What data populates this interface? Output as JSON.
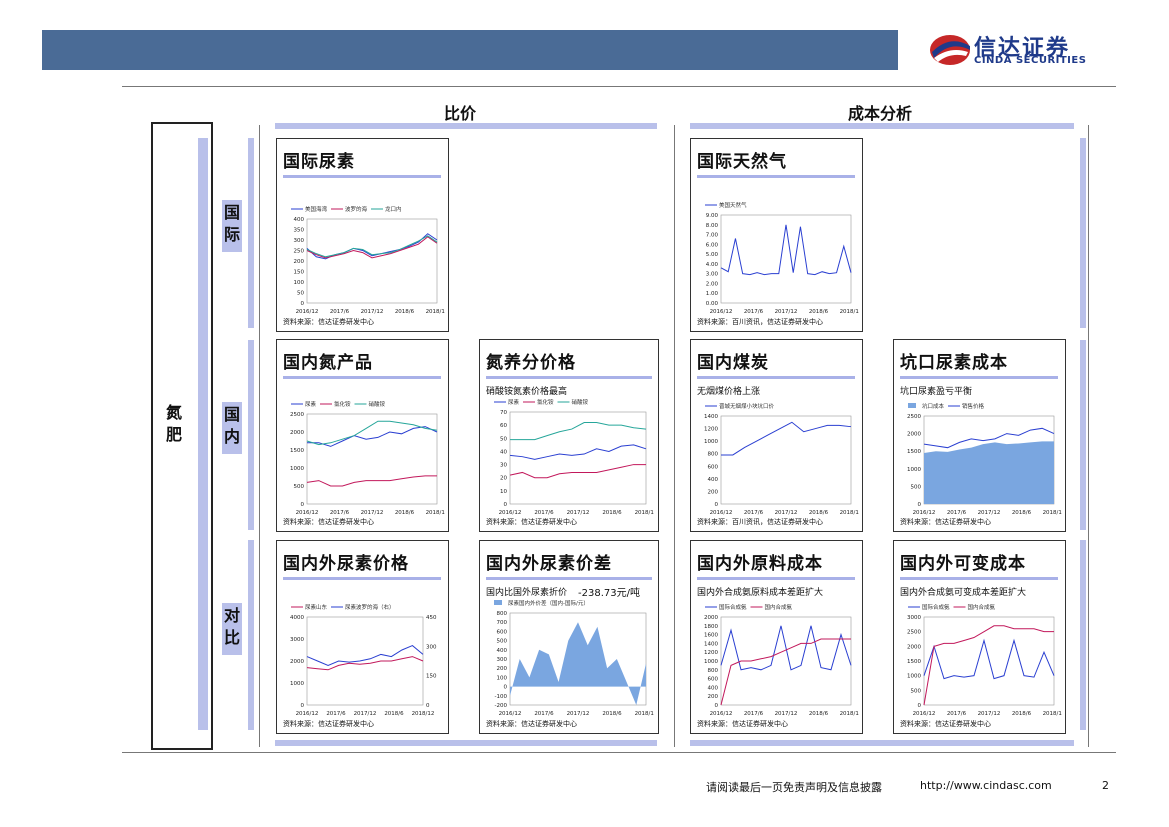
{
  "header": {
    "logo_cn": "信达证券",
    "logo_en": "CINDA SECURITIES"
  },
  "sections": {
    "left": "比价",
    "right": "成本分析"
  },
  "side": {
    "main": "氮肥",
    "rows": [
      "国际",
      "国内",
      "对比"
    ]
  },
  "panels": [
    {
      "id": "p1",
      "title": "国际尿素",
      "subtitle": "",
      "source": "资料来源：信达证券研发中心",
      "legend": [
        "美国海湾",
        "波罗的海",
        "龙口内"
      ]
    },
    {
      "id": "p2",
      "title": "国际天然气",
      "subtitle": "",
      "source": "资料来源：百川资讯，信达证券研发中心",
      "legend": [
        "美国天然气"
      ]
    },
    {
      "id": "p3",
      "title": "国内氮产品",
      "subtitle": "",
      "source": "资料来源：信达证券研发中心",
      "legend": [
        "尿素",
        "氯化铵",
        "硝酸铵"
      ]
    },
    {
      "id": "p4",
      "title": "氮养分价格",
      "subtitle": "硝酸铵氮素价格最高",
      "source": "资料来源：信达证券研发中心",
      "legend": [
        "尿素",
        "氯化铵",
        "硝酸铵"
      ]
    },
    {
      "id": "p5",
      "title": "国内煤炭",
      "subtitle": "无烟煤价格上涨",
      "source": "资料来源：百川资讯，信达证券研发中心",
      "legend": [
        "晋城无烟煤小块坑口价"
      ]
    },
    {
      "id": "p6",
      "title": "坑口尿素成本",
      "subtitle": "坑口尿素盈亏平衡",
      "source": "资料来源：信达证券研发中心",
      "legend": [
        "坑口成本",
        "销售价格"
      ]
    },
    {
      "id": "p7",
      "title": "国内外尿素价格",
      "subtitle": "",
      "source": "资料来源：信达证券研发中心",
      "legend": [
        "尿素山东",
        "尿素波罗的海（右）"
      ]
    },
    {
      "id": "p8",
      "title": "国内外尿素价差",
      "subtitle": "国内比国外尿素折价",
      "value": "-238.73元/吨",
      "source": "资料来源：信达证券研发中心",
      "legend": [
        "尿素国内外价差（国内-国际/元）"
      ]
    },
    {
      "id": "p9",
      "title": "国内外原料成本",
      "subtitle": "国内外合成氨原料成本差距扩大",
      "source": "资料来源：信达证券研发中心",
      "legend": [
        "国际合成氨",
        "国内合成氨"
      ]
    },
    {
      "id": "p10",
      "title": "国内外可变成本",
      "subtitle": "国内外合成氨可变成本差距扩大",
      "source": "资料来源：信达证券研发中心",
      "legend": [
        "国际合成氨",
        "国内合成氨"
      ]
    }
  ],
  "chart_data": [
    {
      "id": "p1",
      "type": "line",
      "x": [
        "2016/12",
        "2017/6",
        "2017/12",
        "2018/6",
        "2018/12"
      ],
      "ylim": [
        0,
        400
      ],
      "yticks": [
        0,
        50,
        100,
        150,
        200,
        250,
        300,
        350,
        400
      ],
      "series": [
        {
          "name": "美国海湾",
          "color": "#2a3fd1",
          "values": [
            260,
            220,
            210,
            230,
            240,
            260,
            250,
            225,
            235,
            245,
            255,
            270,
            290,
            330,
            300
          ]
        },
        {
          "name": "波罗的海",
          "color": "#c2185b",
          "values": [
            250,
            230,
            215,
            225,
            235,
            250,
            240,
            215,
            225,
            235,
            250,
            265,
            280,
            315,
            285
          ]
        },
        {
          "name": "龙口内",
          "color": "#26a69a",
          "values": [
            255,
            235,
            220,
            230,
            240,
            260,
            255,
            230,
            235,
            240,
            255,
            275,
            295,
            320,
            290
          ]
        }
      ]
    },
    {
      "id": "p2",
      "type": "line",
      "x": [
        "2016/12",
        "2017/6",
        "2017/12",
        "2018/6",
        "2018/12"
      ],
      "ylim": [
        0,
        9
      ],
      "yticks": [
        "0.00",
        "1.00",
        "2.00",
        "3.00",
        "4.00",
        "5.00",
        "6.00",
        "7.00",
        "8.00",
        "9.00"
      ],
      "series": [
        {
          "name": "美国天然气",
          "color": "#2a3fd1",
          "values": [
            3.6,
            3.2,
            6.6,
            3.0,
            2.9,
            3.1,
            2.9,
            3.0,
            3.0,
            8.0,
            3.1,
            7.8,
            3.0,
            2.9,
            3.2,
            3.0,
            3.1,
            5.8,
            3.1
          ]
        }
      ]
    },
    {
      "id": "p3",
      "type": "line",
      "x": [
        "2016/12",
        "2017/6",
        "2017/12",
        "2018/6",
        "2018/12"
      ],
      "ylim": [
        0,
        2500
      ],
      "yticks": [
        0,
        500,
        1000,
        1500,
        2000,
        2500
      ],
      "series": [
        {
          "name": "尿素",
          "color": "#2a3fd1",
          "values": [
            1700,
            1700,
            1600,
            1750,
            1900,
            1800,
            1850,
            2000,
            1950,
            2100,
            2150,
            2000
          ]
        },
        {
          "name": "氯化铵",
          "color": "#c2185b",
          "values": [
            600,
            650,
            500,
            500,
            600,
            650,
            650,
            650,
            700,
            750,
            780,
            780
          ]
        },
        {
          "name": "硝酸铵",
          "color": "#26a69a",
          "values": [
            1750,
            1650,
            1700,
            1800,
            1900,
            2100,
            2300,
            2300,
            2250,
            2200,
            2100,
            2050
          ]
        }
      ]
    },
    {
      "id": "p4",
      "type": "line",
      "x": [
        "2016/12",
        "2017/6",
        "2017/12",
        "2018/6",
        "2018/12"
      ],
      "ylim": [
        0,
        70
      ],
      "yticks": [
        0,
        10,
        20,
        30,
        40,
        50,
        60,
        70
      ],
      "series": [
        {
          "name": "尿素",
          "color": "#2a3fd1",
          "values": [
            37,
            36,
            34,
            36,
            38,
            37,
            38,
            42,
            40,
            44,
            45,
            42
          ]
        },
        {
          "name": "氯化铵",
          "color": "#c2185b",
          "values": [
            22,
            24,
            20,
            20,
            23,
            24,
            24,
            24,
            26,
            28,
            30,
            30
          ]
        },
        {
          "name": "硝酸铵",
          "color": "#26a69a",
          "values": [
            49,
            49,
            49,
            52,
            55,
            57,
            62,
            62,
            60,
            60,
            58,
            57
          ]
        }
      ]
    },
    {
      "id": "p5",
      "type": "line",
      "x": [
        "2016/12",
        "2017/6",
        "2017/12",
        "2018/6",
        "2018/12"
      ],
      "ylim": [
        0,
        1400
      ],
      "yticks": [
        0,
        200,
        400,
        600,
        800,
        1000,
        1200,
        1400
      ],
      "series": [
        {
          "name": "晋城无烟煤小块坑口价",
          "color": "#2a3fd1",
          "values": [
            780,
            780,
            900,
            1000,
            1100,
            1200,
            1300,
            1150,
            1200,
            1250,
            1250,
            1230
          ]
        }
      ]
    },
    {
      "id": "p6",
      "type": "area",
      "x": [
        "2016/12",
        "2017/6",
        "2017/12",
        "2018/6",
        "2018/12"
      ],
      "ylim": [
        0,
        2500
      ],
      "yticks": [
        0,
        500,
        1000,
        1500,
        2000,
        2500
      ],
      "series": [
        {
          "name": "坑口成本",
          "color": "#7aa6e0",
          "values": [
            1450,
            1500,
            1480,
            1550,
            1600,
            1700,
            1750,
            1700,
            1720,
            1750,
            1780,
            1780
          ]
        },
        {
          "name": "销售价格",
          "color": "#2a3fd1",
          "values": [
            1700,
            1650,
            1600,
            1750,
            1850,
            1800,
            1850,
            2000,
            1950,
            2100,
            2150,
            2000
          ]
        }
      ]
    },
    {
      "id": "p7",
      "type": "line",
      "x": [
        "2016/12",
        "2017/6",
        "2017/12",
        "2018/6",
        "2018/12"
      ],
      "ylim": [
        0,
        4000
      ],
      "y2lim": [
        0,
        450
      ],
      "yticks": [
        0,
        1000,
        2000,
        3000,
        4000
      ],
      "y2ticks": [
        0,
        150,
        300,
        450
      ],
      "series": [
        {
          "name": "尿素山东",
          "color": "#c2185b",
          "values": [
            1700,
            1650,
            1600,
            1800,
            1900,
            1850,
            1900,
            2000,
            2000,
            2100,
            2200,
            2000
          ]
        },
        {
          "name": "尿素波罗的海（右）",
          "color": "#2a3fd1",
          "values": [
            2200,
            2000,
            1800,
            2000,
            1950,
            2000,
            2100,
            2300,
            2200,
            2500,
            2700,
            2300
          ]
        }
      ]
    },
    {
      "id": "p8",
      "type": "area",
      "x": [
        "2016/12",
        "2017/6",
        "2017/12",
        "2018/6",
        "2018/12"
      ],
      "ylim": [
        -200,
        800
      ],
      "yticks": [
        -200,
        -100,
        0,
        100,
        200,
        300,
        400,
        500,
        600,
        700,
        800
      ],
      "series": [
        {
          "name": "尿素国内外价差（国内-国际/元）",
          "color": "#7aa6e0",
          "values": [
            -100,
            300,
            100,
            400,
            350,
            50,
            500,
            700,
            450,
            650,
            200,
            300,
            50,
            -200,
            250
          ]
        }
      ]
    },
    {
      "id": "p9",
      "type": "line",
      "x": [
        "2016/12",
        "2017/6",
        "2017/12",
        "2018/6",
        "2018/12"
      ],
      "ylim": [
        0,
        2000
      ],
      "yticks": [
        0,
        200,
        400,
        600,
        800,
        1000,
        1200,
        1400,
        1600,
        1800,
        2000
      ],
      "series": [
        {
          "name": "国际合成氨",
          "color": "#2a3fd1",
          "values": [
            900,
            1700,
            800,
            850,
            800,
            900,
            1800,
            800,
            900,
            1800,
            850,
            800,
            1600,
            900
          ]
        },
        {
          "name": "国内合成氨",
          "color": "#c2185b",
          "values": [
            0,
            900,
            1000,
            1000,
            1050,
            1100,
            1200,
            1300,
            1400,
            1400,
            1500,
            1500,
            1500,
            1500
          ]
        }
      ]
    },
    {
      "id": "p10",
      "type": "line",
      "x": [
        "2016/12",
        "2017/6",
        "2017/12",
        "2018/6",
        "2018/12"
      ],
      "ylim": [
        0,
        3000
      ],
      "yticks": [
        0,
        500,
        1000,
        1500,
        2000,
        2500,
        3000
      ],
      "series": [
        {
          "name": "国际合成氨",
          "color": "#2a3fd1",
          "values": [
            1000,
            2000,
            900,
            1000,
            950,
            1000,
            2200,
            900,
            1000,
            2200,
            1000,
            950,
            1800,
            1000
          ]
        },
        {
          "name": "国内合成氨",
          "color": "#c2185b",
          "values": [
            0,
            2000,
            2100,
            2100,
            2200,
            2300,
            2500,
            2700,
            2700,
            2600,
            2600,
            2600,
            2500,
            2500
          ]
        }
      ]
    }
  ],
  "footer": {
    "disclaimer": "请阅读最后一页免责声明及信息披露",
    "url": "http://www.cindasc.com",
    "page": "2"
  }
}
